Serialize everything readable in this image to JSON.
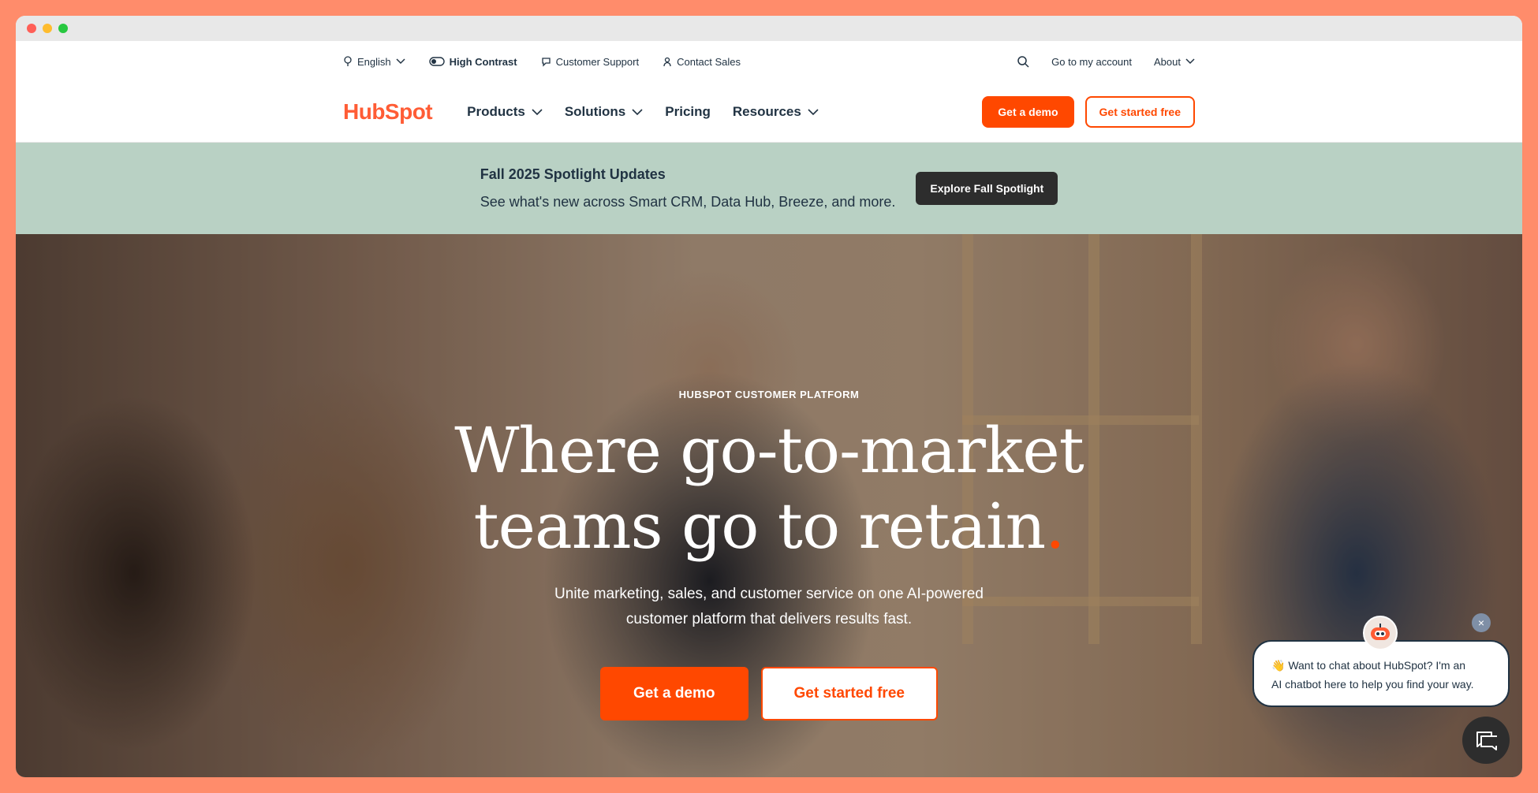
{
  "utility": {
    "language": "English",
    "high_contrast": "High Contrast",
    "customer_support": "Customer Support",
    "contact_sales": "Contact Sales",
    "account": "Go to my account",
    "about": "About"
  },
  "nav": {
    "logo": "HubSpot",
    "items": [
      {
        "label": "Products"
      },
      {
        "label": "Solutions"
      },
      {
        "label": "Pricing"
      },
      {
        "label": "Resources"
      }
    ],
    "demo": "Get a demo",
    "start": "Get started free"
  },
  "banner": {
    "title": "Fall 2025 Spotlight Updates",
    "subtitle": "See what's new across Smart CRM, Data Hub, Breeze, and more.",
    "cta": "Explore Fall Spotlight",
    "bg_color": "#b9d1c4"
  },
  "hero": {
    "eyebrow": "HUBSPOT CUSTOMER PLATFORM",
    "headline_line1": "Where go-to-market",
    "headline_line2": "teams go to retain",
    "headline_period": ".",
    "subcopy_line1": "Unite marketing, sales, and customer service on one AI-powered",
    "subcopy_line2": "customer platform that delivers results fast.",
    "demo": "Get a demo",
    "start": "Get started free"
  },
  "chat": {
    "message_line1": "👋 Want to chat about HubSpot? I'm an",
    "message_line2": "AI chatbot here to help you find your way.",
    "close": "×"
  },
  "colors": {
    "brand": "#ff4800",
    "dark": "#213343"
  }
}
